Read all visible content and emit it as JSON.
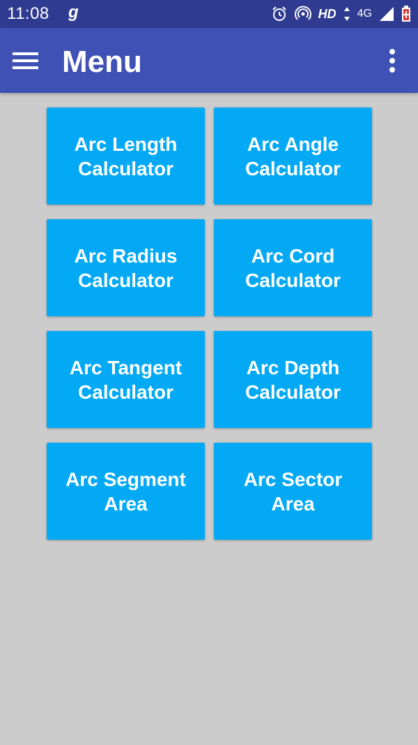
{
  "status_bar": {
    "time": "11:08",
    "carrier_glyph": "g",
    "network": "HD",
    "signal_type": "4G",
    "icons": [
      "alarm-icon",
      "hotspot-icon",
      "data-arrows-icon",
      "signal-icon",
      "battery-icon"
    ],
    "battery_color": "#e53935"
  },
  "app_bar": {
    "title": "Menu",
    "nav_icon": "hamburger-menu-icon",
    "overflow_icon": "more-vert-icon",
    "color": "#3f51b5"
  },
  "menu": {
    "tile_color": "#03a9f4",
    "items": [
      {
        "label": "Arc Length Calculator"
      },
      {
        "label": "Arc Angle Calculator"
      },
      {
        "label": "Arc Radius Calculator"
      },
      {
        "label": "Arc Cord Calculator"
      },
      {
        "label": "Arc Tangent Calculator"
      },
      {
        "label": "Arc Depth Calculator"
      },
      {
        "label": "Arc Segment Area"
      },
      {
        "label": "Arc Sector Area"
      }
    ]
  }
}
